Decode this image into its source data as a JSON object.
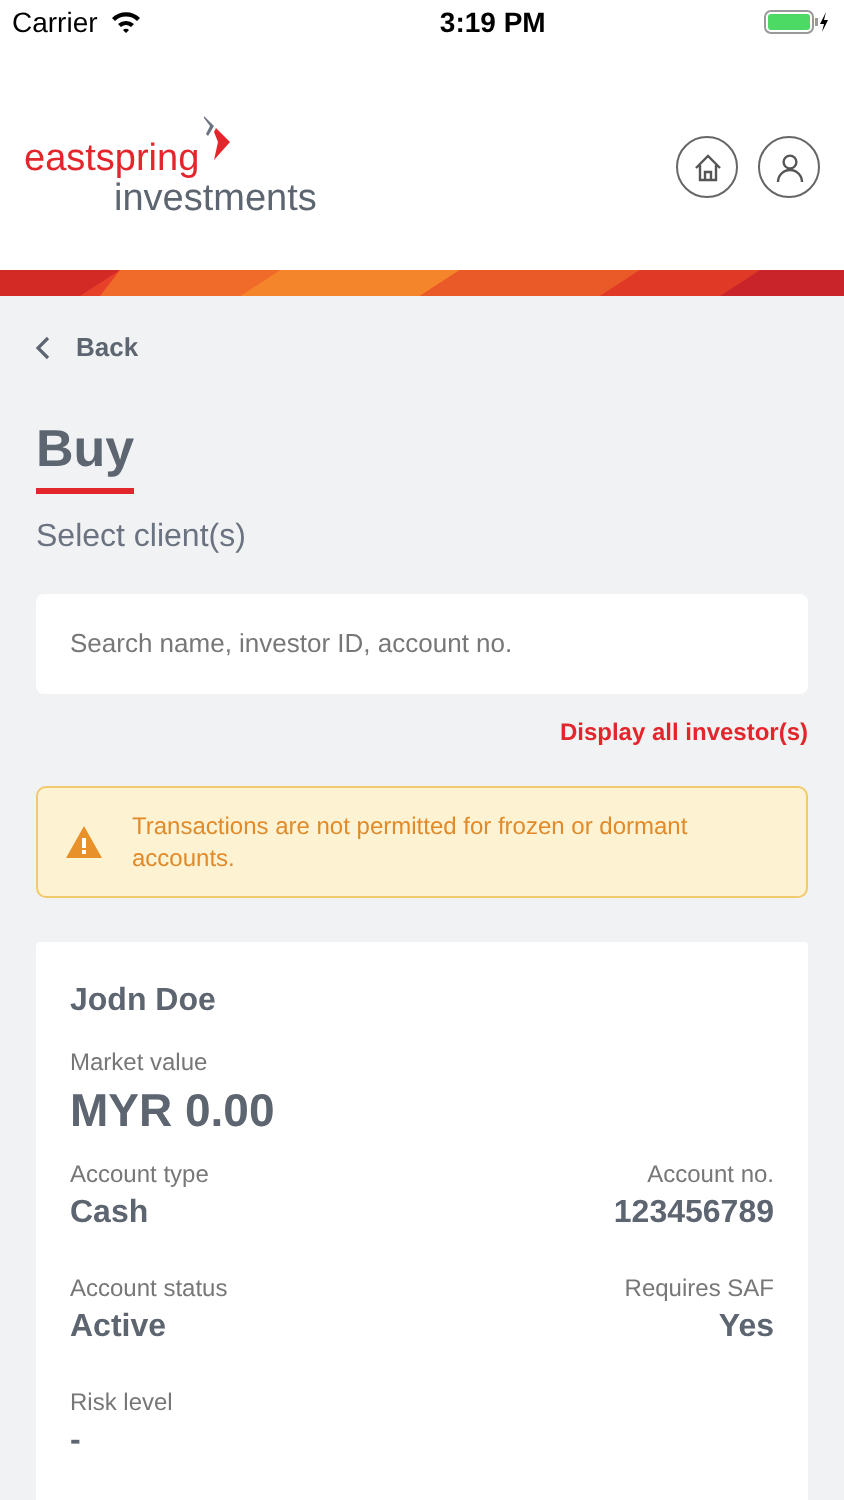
{
  "status_bar": {
    "carrier": "Carrier",
    "time": "3:19 PM"
  },
  "header": {
    "logo_top": "eastspring",
    "logo_bottom": "investments"
  },
  "back": "Back",
  "title": "Buy",
  "subtitle": "Select client(s)",
  "search": {
    "placeholder": "Search name, investor ID, account no."
  },
  "display_all_link": "Display all investor(s)",
  "alert": {
    "text": "Transactions are not permitted for frozen or dormant accounts."
  },
  "client": {
    "name": "Jodn Doe",
    "market_value_label": "Market value",
    "market_value": "MYR 0.00",
    "rows": [
      {
        "left": {
          "label": "Account type",
          "value": "Cash"
        },
        "right": {
          "label": "Account no.",
          "value": "123456789"
        }
      },
      {
        "left": {
          "label": "Account status",
          "value": "Active"
        },
        "right": {
          "label": "Requires SAF",
          "value": "Yes"
        }
      },
      {
        "left": {
          "label": "Risk level",
          "value": "-"
        }
      }
    ]
  }
}
